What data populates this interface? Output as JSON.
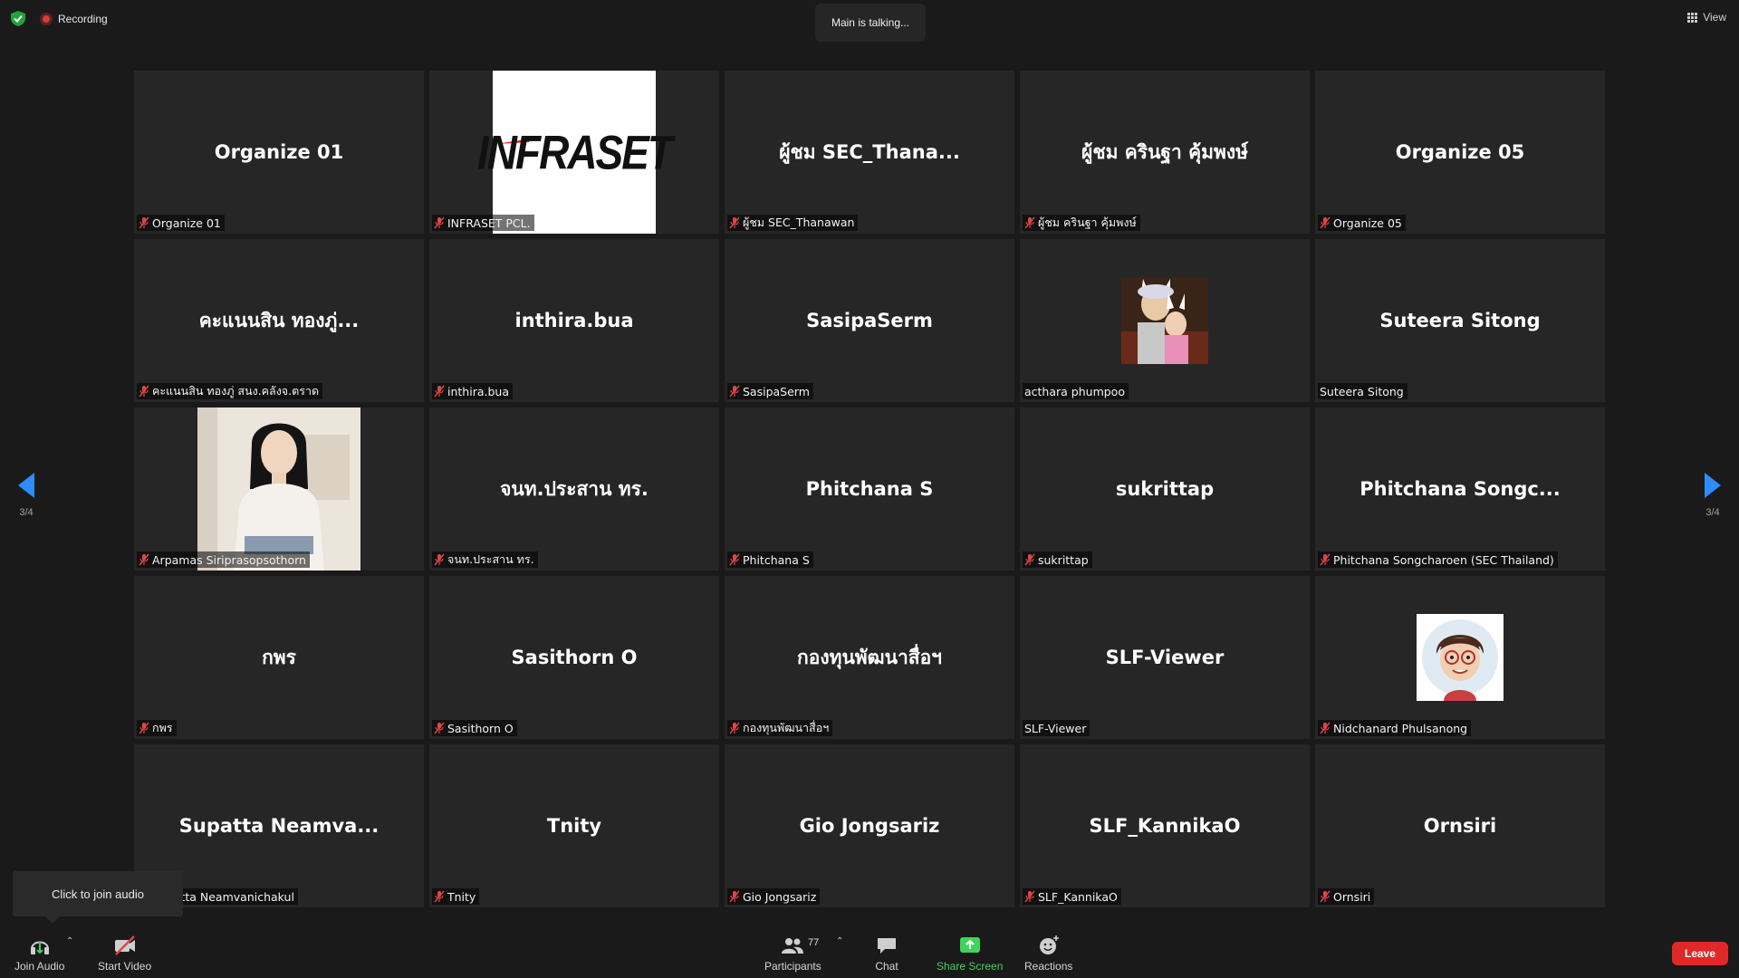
{
  "top_bar": {
    "recording_label": "Recording",
    "talking_indicator": "Main is talking...",
    "view_label": "View"
  },
  "pager": {
    "left_page": "3/4",
    "right_page": "3/4"
  },
  "tiles": [
    {
      "display_name": "Organize 01",
      "label": "Organize 01",
      "muted": true
    },
    {
      "display_name": "",
      "label": "INFRASET PCL.",
      "muted": true,
      "logo_text": "INFRASET"
    },
    {
      "display_name": "ผู้ชม SEC_Thana...",
      "label": "ผู้ชม SEC_Thanawan",
      "muted": true
    },
    {
      "display_name": "ผู้ชม ครินฐา คุ้มพงษ์",
      "label": "ผู้ชม ครินฐา คุ้มพงษ์",
      "muted": true
    },
    {
      "display_name": "Organize 05",
      "label": "Organize 05",
      "muted": true
    },
    {
      "display_name": "คะแนนสิน ทองภู่...",
      "label": "คะแนนสิน ทองภู่ สนง.คลังจ.ตราด",
      "muted": true
    },
    {
      "display_name": "inthira.bua",
      "label": "inthira.bua",
      "muted": true
    },
    {
      "display_name": "SasipaSerm",
      "label": "SasipaSerm",
      "muted": true
    },
    {
      "display_name": "",
      "label": "acthara phumpoo",
      "muted": false
    },
    {
      "display_name": "Suteera Sitong",
      "label": "Suteera Sitong",
      "muted": false
    },
    {
      "display_name": "",
      "label": "Arpamas Siriprasopsothorn",
      "muted": true
    },
    {
      "display_name": "จนท.ประสาน  ทร.",
      "label": "จนท.ประสาน  ทร.",
      "muted": true
    },
    {
      "display_name": "Phitchana S",
      "label": "Phitchana S",
      "muted": true
    },
    {
      "display_name": "sukrittap",
      "label": "sukrittap",
      "muted": true
    },
    {
      "display_name": "Phitchana  Songc...",
      "label": "Phitchana Songcharoen (SEC Thailand)",
      "muted": true
    },
    {
      "display_name": "กพร",
      "label": "กพร",
      "muted": true
    },
    {
      "display_name": "Sasithorn O",
      "label": "Sasithorn O",
      "muted": true
    },
    {
      "display_name": "กองทุนพัฒนาสื่อฯ",
      "label": "กองทุนพัฒนาสื่อฯ",
      "muted": true
    },
    {
      "display_name": "SLF-Viewer",
      "label": "SLF-Viewer",
      "muted": false
    },
    {
      "display_name": "",
      "label": "Nidchanard Phulsanong",
      "muted": true
    },
    {
      "display_name": "Supatta  Neamva...",
      "label": "Supatta Neamvanichakul",
      "muted": true
    },
    {
      "display_name": "Tnity",
      "label": "Tnity",
      "muted": true
    },
    {
      "display_name": "Gio Jongsariz",
      "label": "Gio Jongsariz",
      "muted": true
    },
    {
      "display_name": "SLF_KannikaO",
      "label": "SLF_KannikaO",
      "muted": true
    },
    {
      "display_name": "Ornsiri",
      "label": "Ornsiri",
      "muted": true
    }
  ],
  "tooltip": {
    "text": "Click to join audio"
  },
  "toolbar": {
    "join_audio": "Join Audio",
    "start_video": "Start Video",
    "participants": "Participants",
    "participants_count": "77",
    "chat": "Chat",
    "share_screen": "Share Screen",
    "reactions": "Reactions",
    "leave": "Leave"
  },
  "colors": {
    "accent_blue": "#2d8cff",
    "leave_red": "#e02828",
    "share_green": "#3fd45b",
    "tile_bg": "#262626"
  }
}
